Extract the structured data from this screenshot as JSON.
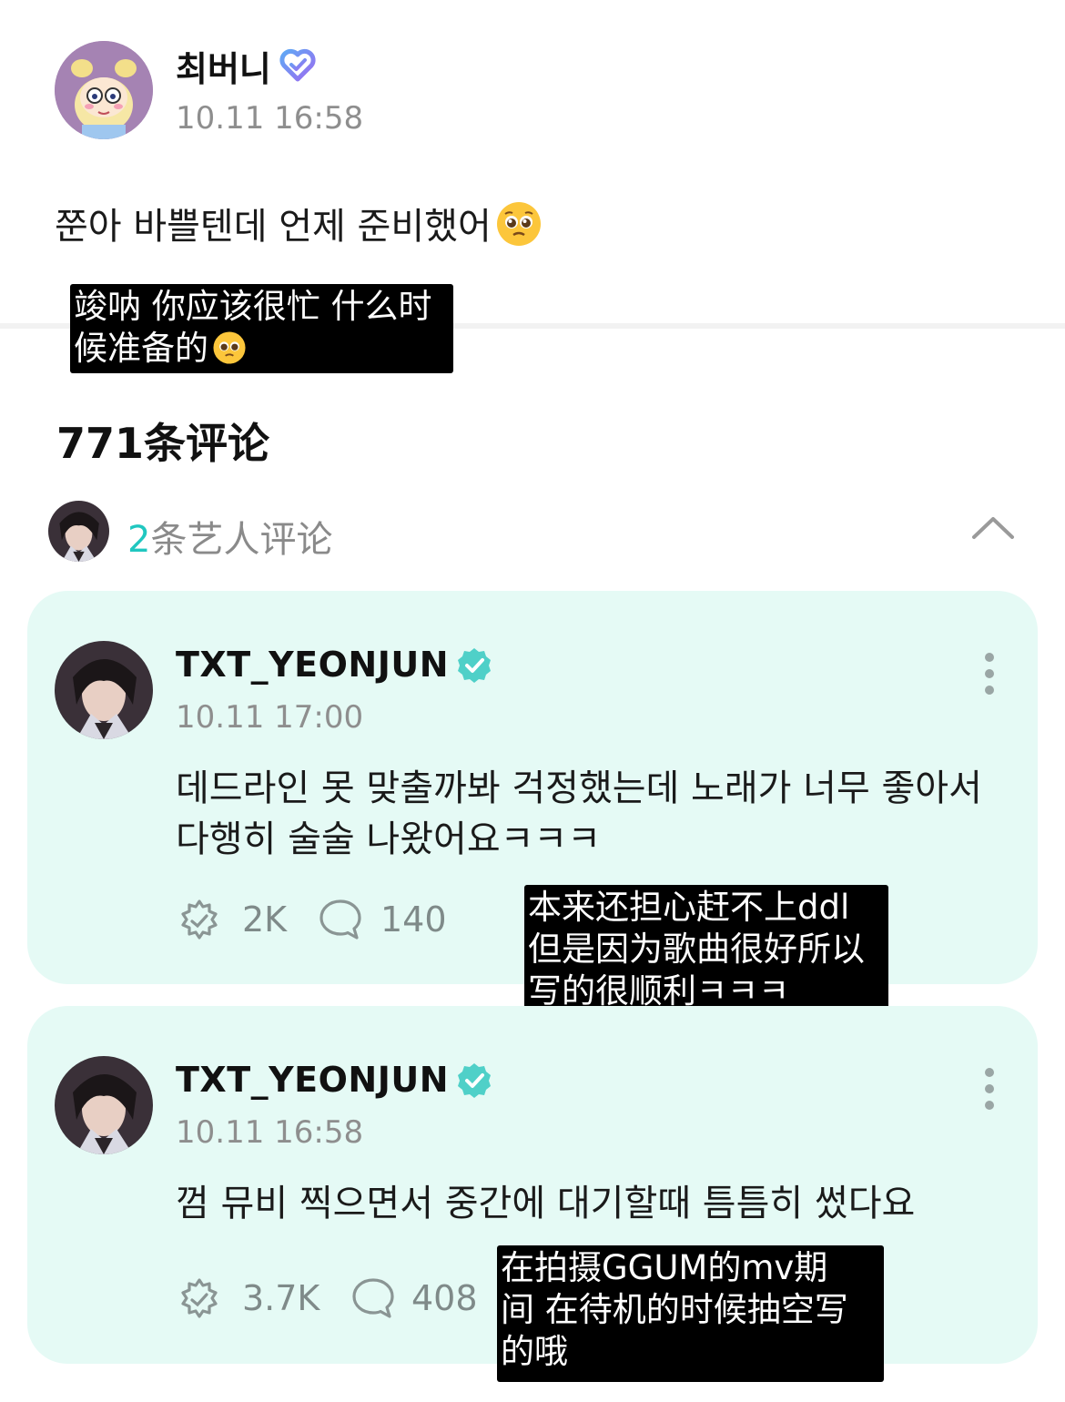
{
  "post": {
    "author": "최버니",
    "time": "10.11 16:58",
    "text": "쭌아 바쁠텐데 언제 준비했어",
    "caption_line1": "竣呐 你应该很忙 什么时",
    "caption_line2": "候准备的"
  },
  "comments": {
    "title": "771条评论",
    "artist_count": "2",
    "artist_label": "条艺人评论"
  },
  "artist_comments": [
    {
      "author": "TXT_YEONJUN",
      "time": "10.11 17:00",
      "text": "데드라인 못 맞출까봐 걱정했는데 노래가 너무 좋아서 다행히 술술 나왔어요ㅋㅋㅋ",
      "likes": "2K",
      "replies": "140",
      "caption_line1": "本来还担心赶不上ddl",
      "caption_line2": "但是因为歌曲很好所以",
      "caption_line3": "写的很顺利ㅋㅋㅋ"
    },
    {
      "author": "TXT_YEONJUN",
      "time": "10.11 16:58",
      "text": "껌 뮤비 찍으면서 중간에 대기할때 틈틈히 썼다요",
      "likes": "3.7K",
      "replies": "408",
      "caption_line1": "在拍摄GGUM的mv期",
      "caption_line2": "间 在待机的时候抽空写",
      "caption_line3": "的哦"
    }
  ],
  "colors": {
    "card_bg": "#e5faf5",
    "accent_teal": "#20c7c0",
    "verified_badge": "#4fd0c8",
    "heart_badge": "#8a7cf0"
  },
  "icons": [
    "pleading-face-icon",
    "verified-heart-icon",
    "verified-badge-icon",
    "chevron-up-icon",
    "more-vertical-icon",
    "like-icon",
    "reply-icon"
  ]
}
